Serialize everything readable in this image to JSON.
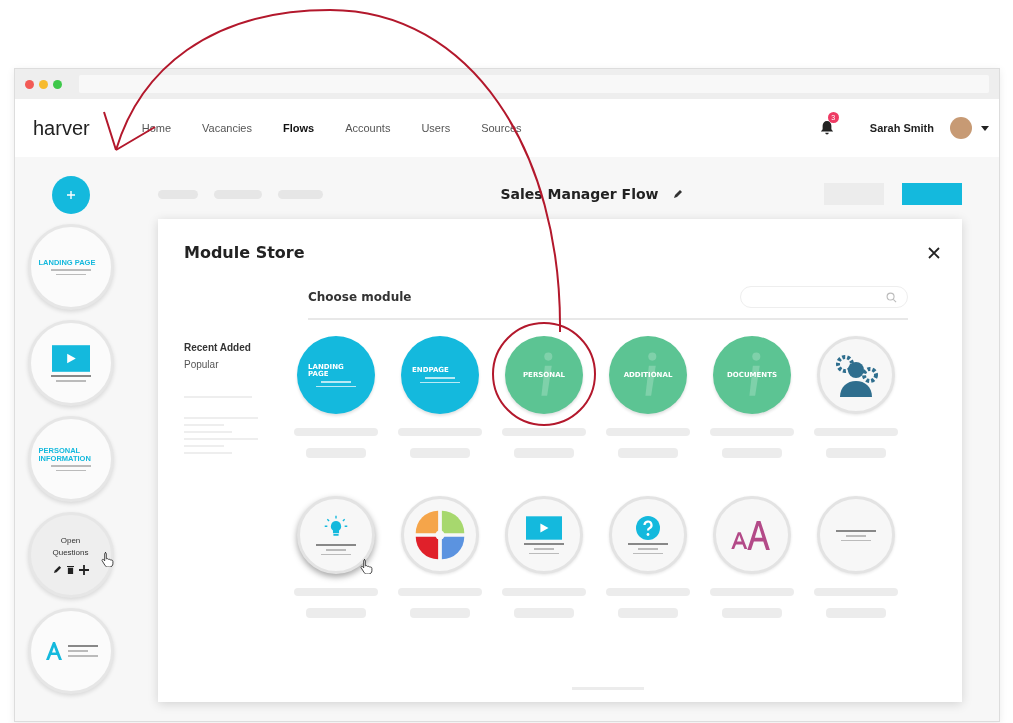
{
  "nav": {
    "logo": "harver",
    "items": [
      {
        "label": "Home",
        "selected": false
      },
      {
        "label": "Vacancies",
        "selected": false
      },
      {
        "label": "Flows",
        "selected": true
      },
      {
        "label": "Accounts",
        "selected": false
      },
      {
        "label": "Users",
        "selected": false
      },
      {
        "label": "Sources",
        "selected": false
      }
    ],
    "notifications": "3",
    "user": "Sarah Smith"
  },
  "flow": {
    "title": "Sales Manager Flow"
  },
  "steps": [
    {
      "kind": "landing",
      "label": "LANDING PAGE",
      "hovered": false
    },
    {
      "kind": "video",
      "hovered": false
    },
    {
      "kind": "personal",
      "label": "PERSONAL INFORMATION",
      "hovered": false
    },
    {
      "kind": "open_questions",
      "label": "Open Questions",
      "hovered": true
    },
    {
      "kind": "text",
      "hovered": false
    }
  ],
  "store": {
    "title": "Module Store",
    "categories": [
      {
        "label": "Recent Added",
        "selected": true
      },
      {
        "label": "Popular",
        "selected": false
      }
    ],
    "heading": "Choose module",
    "modules": [
      {
        "kind": "page",
        "label": "LANDING PAGE",
        "color": "#14b9dd",
        "highlighted": false
      },
      {
        "kind": "page",
        "label": "ENDPAGE",
        "color": "#14b9dd",
        "highlighted": false
      },
      {
        "kind": "info",
        "label": "PERSONAL",
        "color": "#5cc493",
        "highlighted": true
      },
      {
        "kind": "info",
        "label": "ADDITIONAL",
        "color": "#5cc493",
        "highlighted": false
      },
      {
        "kind": "info",
        "label": "DOCUMENTS",
        "color": "#5cc493",
        "highlighted": false
      },
      {
        "kind": "team",
        "highlighted": false
      }
    ],
    "more_modules": [
      {
        "kind": "bulb",
        "hovered": true
      },
      {
        "kind": "wheel",
        "hovered": false
      },
      {
        "kind": "video",
        "hovered": false
      },
      {
        "kind": "question",
        "hovered": false
      },
      {
        "kind": "font",
        "hovered": false
      },
      {
        "kind": "blank",
        "hovered": false
      }
    ]
  }
}
